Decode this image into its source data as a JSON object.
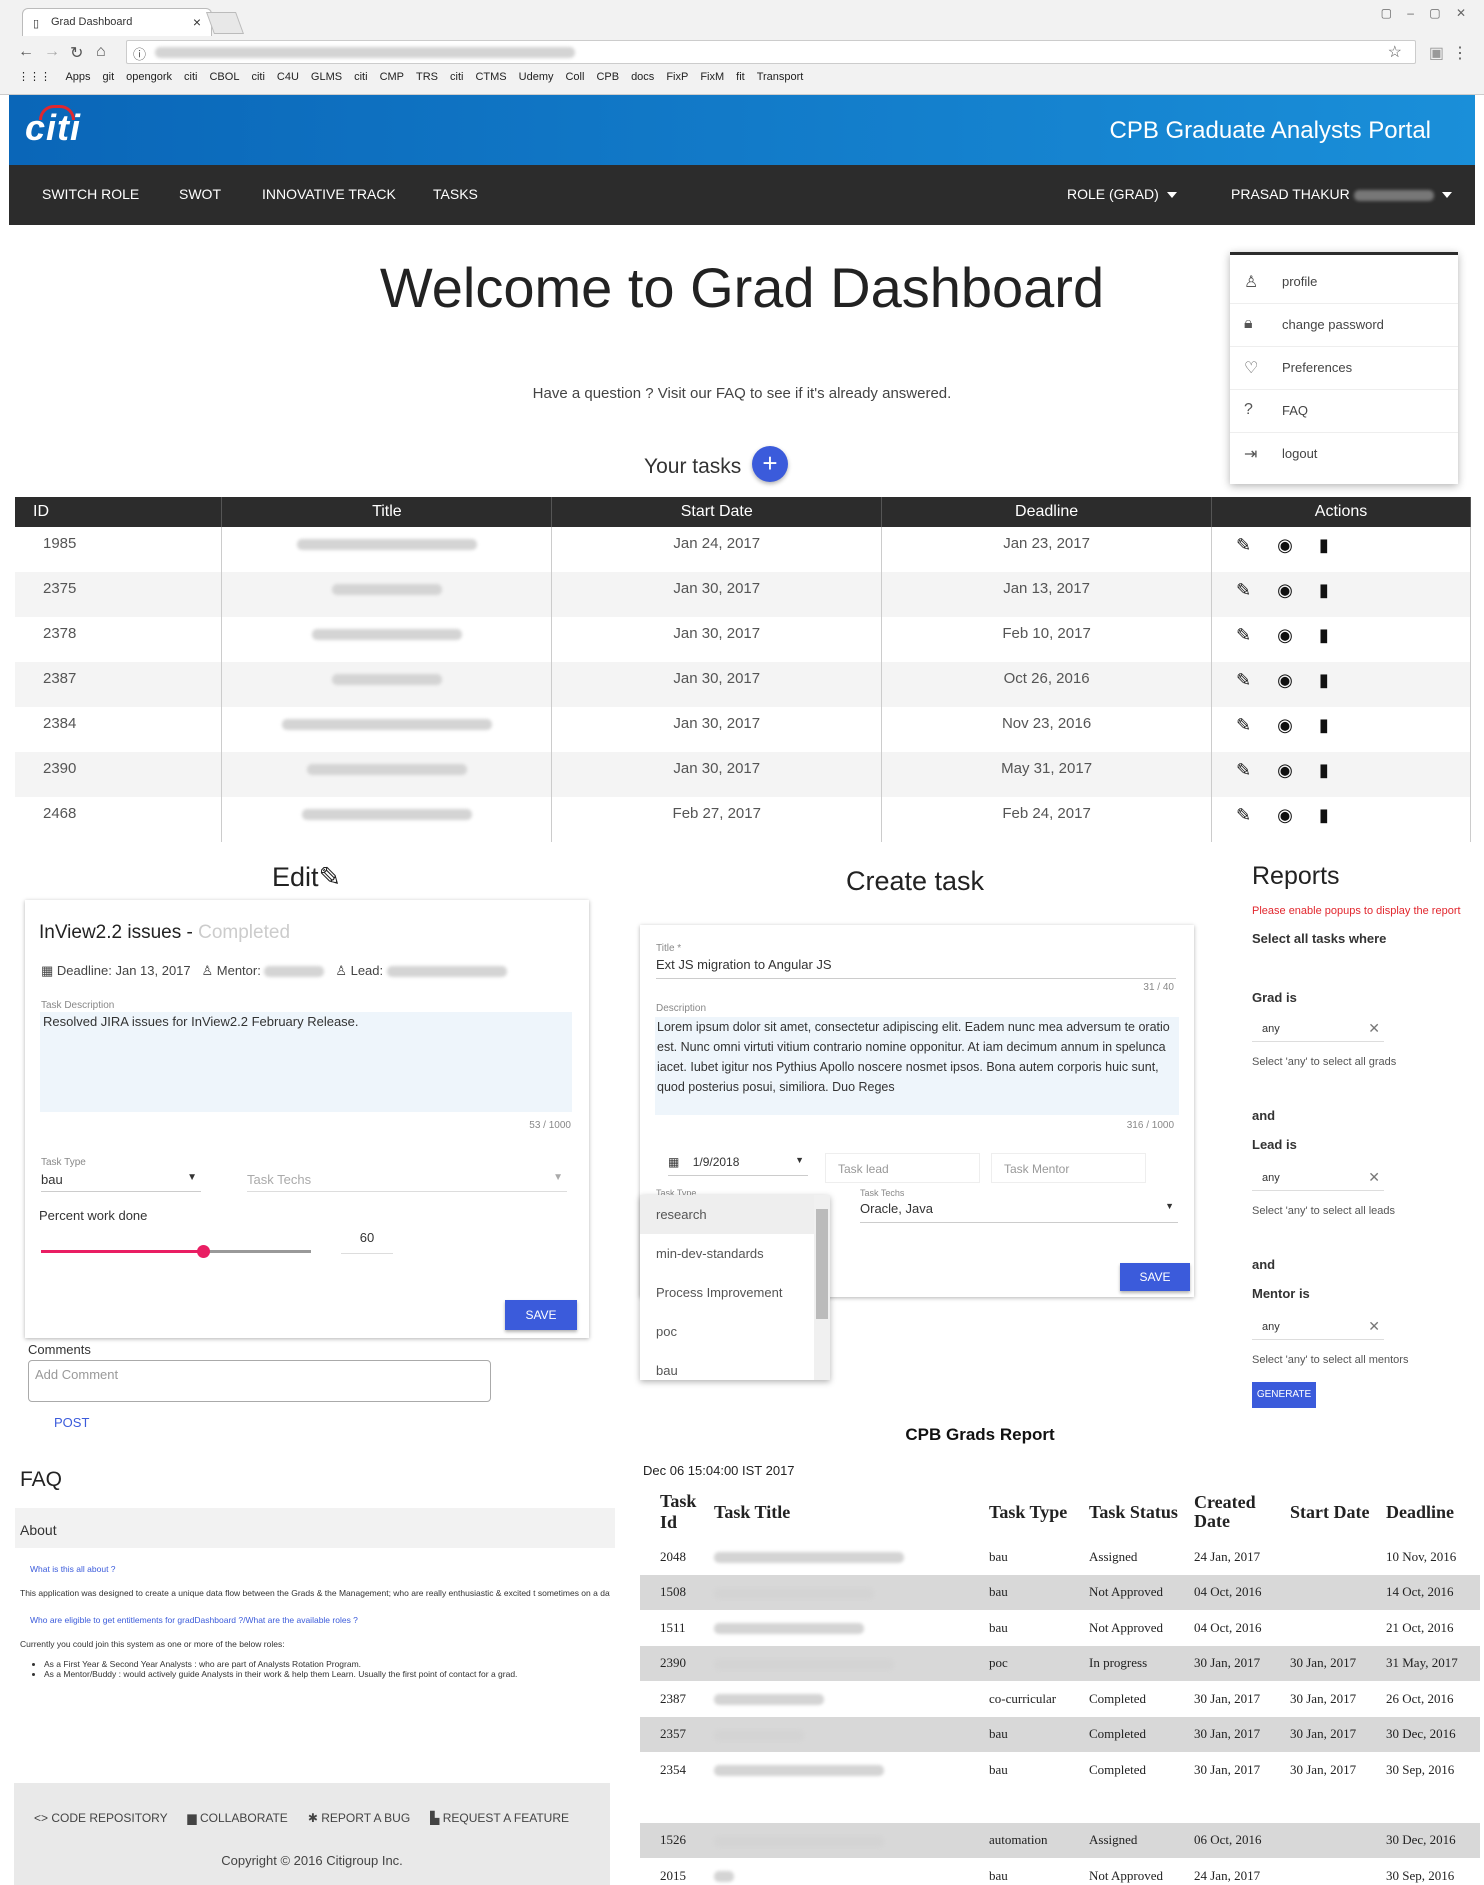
{
  "browser": {
    "tab_title": "Grad Dashboard",
    "bookmarks": [
      "Apps",
      "git",
      "opengork",
      "citi",
      "CBOL",
      "citi",
      "C4U",
      "GLMS",
      "citi",
      "CMP",
      "TRS",
      "citi",
      "CTMS",
      "Udemy",
      "Coll",
      "CPB",
      "docs",
      "FixP",
      "FixM",
      "fit",
      "Transport"
    ]
  },
  "header": {
    "logo": "citi",
    "portal_title": "CPB Graduate Analysts Portal"
  },
  "nav": {
    "items": [
      "SWITCH ROLE",
      "SWOT",
      "INNOVATIVE TRACK",
      "TASKS"
    ],
    "role": "ROLE (GRAD)",
    "user": "PRASAD THAKUR"
  },
  "user_menu": {
    "items": [
      "profile",
      "change password",
      "Preferences",
      "FAQ",
      "logout"
    ]
  },
  "welcome": {
    "title": "Welcome to Grad Dashboard",
    "faq_prompt": "Have a question ? Visit our FAQ to see if it's already answered."
  },
  "tasks": {
    "heading": "Your tasks",
    "add_label": "+",
    "columns": [
      "ID",
      "Title",
      "Start Date",
      "Deadline",
      "Actions"
    ],
    "rows": [
      {
        "id": "1985",
        "start": "Jan 24, 2017",
        "deadline": "Jan 23, 2017"
      },
      {
        "id": "2375",
        "start": "Jan 30, 2017",
        "deadline": "Jan 13, 2017"
      },
      {
        "id": "2378",
        "start": "Jan 30, 2017",
        "deadline": "Feb 10, 2017"
      },
      {
        "id": "2387",
        "start": "Jan 30, 2017",
        "deadline": "Oct 26, 2016"
      },
      {
        "id": "2384",
        "start": "Jan 30, 2017",
        "deadline": "Nov 23, 2016"
      },
      {
        "id": "2390",
        "start": "Jan 30, 2017",
        "deadline": "May 31, 2017"
      },
      {
        "id": "2468",
        "start": "Feb 27, 2017",
        "deadline": "Feb 24, 2017"
      }
    ]
  },
  "edit": {
    "heading": "Edit",
    "task_title": "InView2.2 issues -",
    "status": "Completed",
    "deadline": "Deadline: Jan 13, 2017",
    "mentor_label": "Mentor:",
    "lead_label": "Lead:",
    "desc_label": "Task Description",
    "description": "Resolved JIRA  issues for InView2.2 February Release.",
    "counter": "53 / 1000",
    "type_label": "Task Type",
    "type_value": "bau",
    "techs_placeholder": "Task Techs",
    "percent_label": "Percent work done",
    "percent_value": "60",
    "percent": 60,
    "save": "SAVE",
    "comments_label": "Comments",
    "comment_placeholder": "Add Comment",
    "post": "POST"
  },
  "create": {
    "heading": "Create task",
    "title_label": "Title *",
    "title_value": "Ext JS migration to Angular JS",
    "title_counter": "31 / 40",
    "desc_label": "Description",
    "description": "Lorem ipsum dolor sit amet, consectetur adipiscing elit. Eadem nunc mea adversum te oratio est. Nunc omni virtuti vitium contrario nomine opponitur. At iam decimum annum in spelunca iacet. Iubet igitur nos Pythius Apollo noscere nosmet ipsos. Bona autem corporis huic sunt, quod posterius posui, similiora. Duo Reges",
    "desc_counter": "316 / 1000",
    "date": "1/9/2018",
    "lead_placeholder": "Task lead",
    "mentor_placeholder": "Task Mentor",
    "type_label": "Task Type",
    "techs_label": "Task Techs",
    "techs_value": "Oracle, Java",
    "save": "SAVE",
    "type_options": [
      "research",
      "min-dev-standards",
      "Process Improvement",
      "poc",
      "bau"
    ]
  },
  "reports": {
    "heading": "Reports",
    "warning": "Please enable popups to display the report",
    "select_all": "Select all tasks where",
    "grad_label": "Grad is",
    "grad_value": "any",
    "grad_hint": "Select 'any' to select all grads",
    "and1": "and",
    "lead_label": "Lead is",
    "lead_value": "any",
    "lead_hint": "Select 'any' to select all leads",
    "and2": "and",
    "mentor_label": "Mentor is",
    "mentor_value": "any",
    "mentor_hint": "Select 'any' to select all mentors",
    "generate": "GENERATE"
  },
  "faq": {
    "heading": "FAQ",
    "section": "About",
    "q1": "What is this all about ?",
    "a1": "This application was designed to create a unique data flow between the Grads & the Management; who are really enthusiastic & excited t sometimes on a day to day basis). Technically this application is designed by Analysts for the Analysts. It makes various day to day activit them from both ends will provide insightful data on the whole Analysts Program as well as proficiency details on individuals",
    "q2": "Who are eligible to get entitlements for gradDashboard ?/What are the available roles ?",
    "a2": "Currently you could join this system as one or more of the below roles:",
    "roles": [
      "As a First Year & Second Year Analysts : who are part of Analysts Rotation Program.",
      "As a Mentor/Buddy : would actively guide Analysts in their work & help them Learn. Usually the first point of contact for a grad."
    ]
  },
  "footer": {
    "links": [
      "CODE REPOSITORY",
      "COLLABORATE",
      "REPORT A BUG",
      "REQUEST A FEATURE"
    ],
    "copyright": "Copyright © 2016 Citigroup Inc."
  },
  "grads_report": {
    "title": "CPB Grads Report",
    "date": "Dec 06 15:04:00 IST 2017",
    "columns": [
      "Task Id",
      "Task Title",
      "Task Type",
      "Task Status",
      "Created Date",
      "Start Date",
      "Deadline"
    ],
    "rows": [
      {
        "id": "2048",
        "type": "bau",
        "status": "Assigned",
        "created": "24 Jan, 2017",
        "start": "",
        "deadline": "10 Nov, 2016"
      },
      {
        "id": "1508",
        "type": "bau",
        "status": "Not Approved",
        "created": "04 Oct, 2016",
        "start": "",
        "deadline": "14 Oct, 2016"
      },
      {
        "id": "1511",
        "type": "bau",
        "status": "Not Approved",
        "created": "04 Oct, 2016",
        "start": "",
        "deadline": "21 Oct, 2016"
      },
      {
        "id": "2390",
        "type": "poc",
        "status": "In progress",
        "created": "30 Jan, 2017",
        "start": "30 Jan, 2017",
        "deadline": "31 May, 2017"
      },
      {
        "id": "2387",
        "type": "co-curricular",
        "status": "Completed",
        "created": "30 Jan, 2017",
        "start": "30 Jan, 2017",
        "deadline": "26 Oct, 2016"
      },
      {
        "id": "2357",
        "type": "bau",
        "status": "Completed",
        "created": "30 Jan, 2017",
        "start": "30 Jan, 2017",
        "deadline": "30 Dec, 2016"
      },
      {
        "id": "2354",
        "type": "bau",
        "status": "Completed",
        "created": "30 Jan, 2017",
        "start": "30 Jan, 2017",
        "deadline": "30 Sep, 2016"
      },
      {
        "id": "1526",
        "type": "automation",
        "status": "Assigned",
        "created": "06 Oct, 2016",
        "start": "",
        "deadline": "30 Dec, 2016"
      },
      {
        "id": "2015",
        "type": "bau",
        "status": "Not Approved",
        "created": "24 Jan, 2017",
        "start": "",
        "deadline": "30 Sep, 2016"
      }
    ]
  },
  "colors": {
    "brand": "#1a8fd9",
    "nav": "#2c2c2c",
    "primary": "#3b5bdb",
    "slider": "#e91e63",
    "warning": "#e2272e"
  }
}
